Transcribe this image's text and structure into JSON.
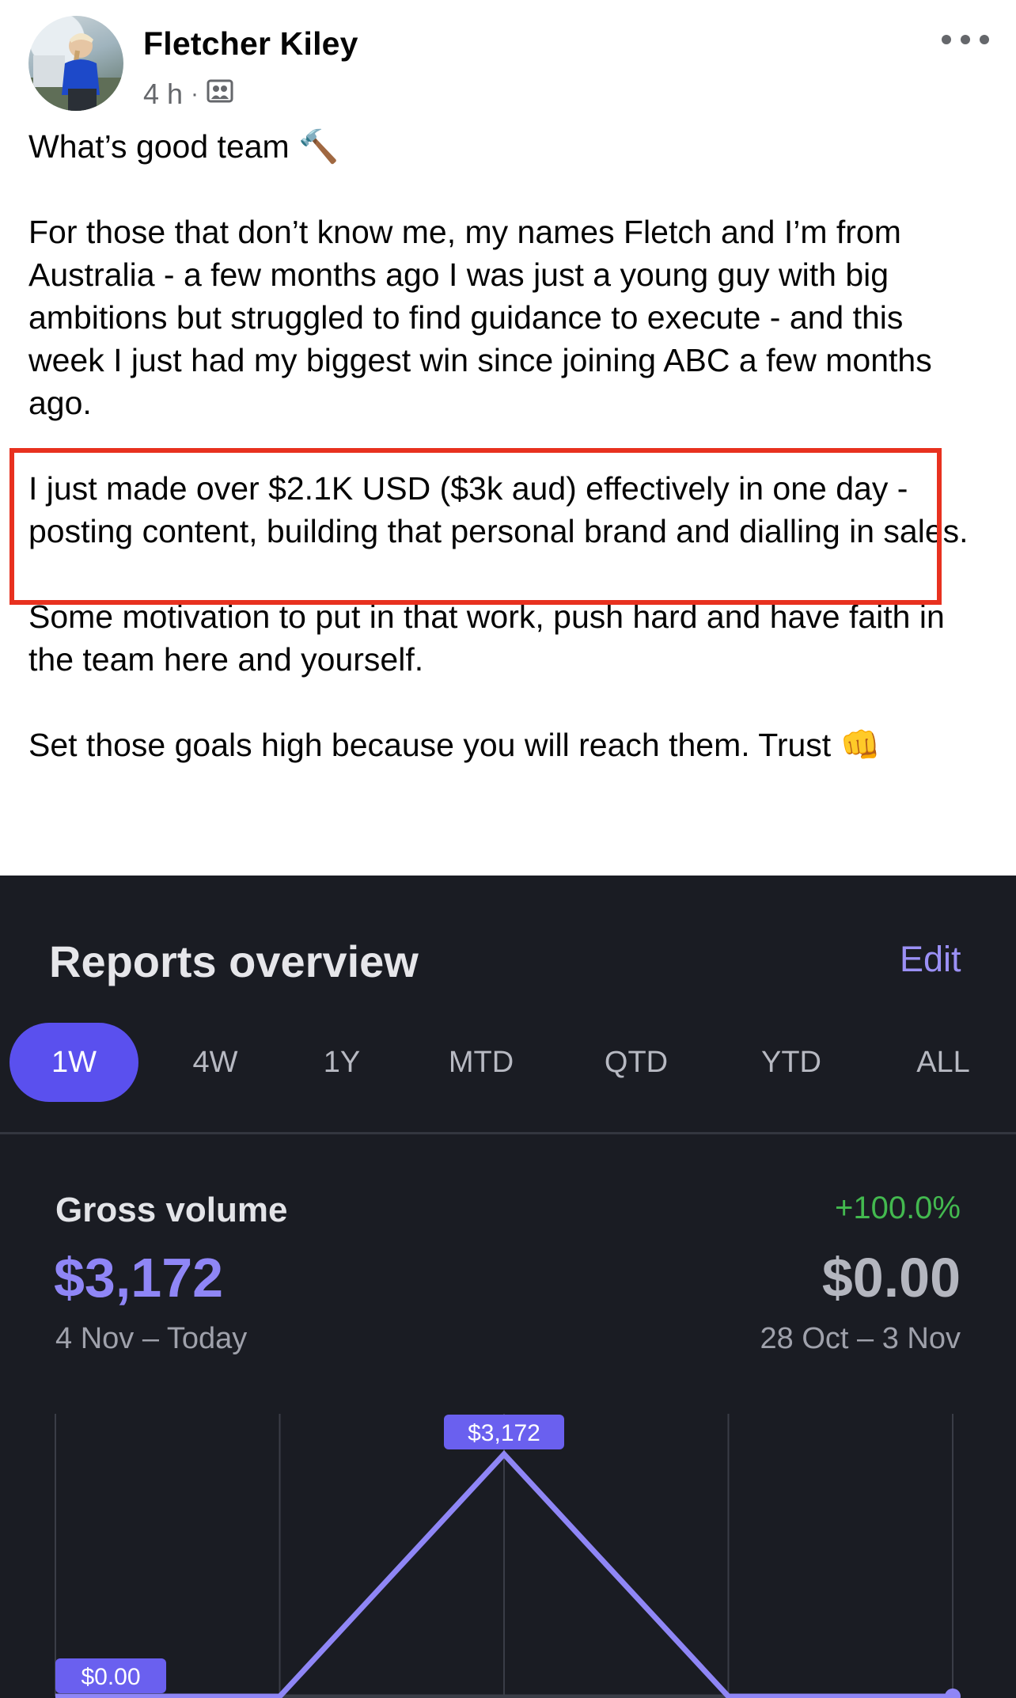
{
  "post": {
    "author": "Fletcher Kiley",
    "time": "4 h",
    "separator": "·",
    "paragraphs": [
      "What’s good team 🔨",
      "For those that don’t know me, my names Fletch and I’m from Australia - a few months ago I was just a young guy with big ambitions but struggled to find guidance to execute - and this week I just had my biggest win since joining ABC a few months ago.",
      "I just made over $2.1K USD ($3k aud) effectively in one day - posting content, building that personal brand and dialling in sales.",
      "Some motivation to put in that work, push hard and have faith in the team here and yourself.",
      "Set those goals high because you will reach them. Trust 👊"
    ],
    "icons": {
      "audience": "group-audience-icon",
      "more": "more-options-icon"
    },
    "highlight_color": "#e8311f"
  },
  "reports": {
    "title": "Reports overview",
    "edit_label": "Edit",
    "tabs": [
      "1W",
      "4W",
      "1Y",
      "MTD",
      "QTD",
      "YTD",
      "ALL"
    ],
    "active_tab": "1W",
    "accent_color": "#5a50ee",
    "gross_volume": {
      "label": "Gross volume",
      "value": "$3,172",
      "range": "4 Nov – Today",
      "change": "+100.0%",
      "previous_value": "$0.00",
      "previous_range": "28 Oct – 3 Nov"
    }
  },
  "chart_data": {
    "type": "line",
    "x": [
      0,
      1,
      2,
      3,
      4
    ],
    "series": [
      {
        "values": [
          0,
          0,
          3172,
          0,
          0
        ]
      }
    ],
    "ylim": [
      0,
      3172
    ],
    "data_labels": {
      "peak": "$3,172",
      "start": "$0.00"
    },
    "line_color": "#8f86f6",
    "grid": true
  }
}
